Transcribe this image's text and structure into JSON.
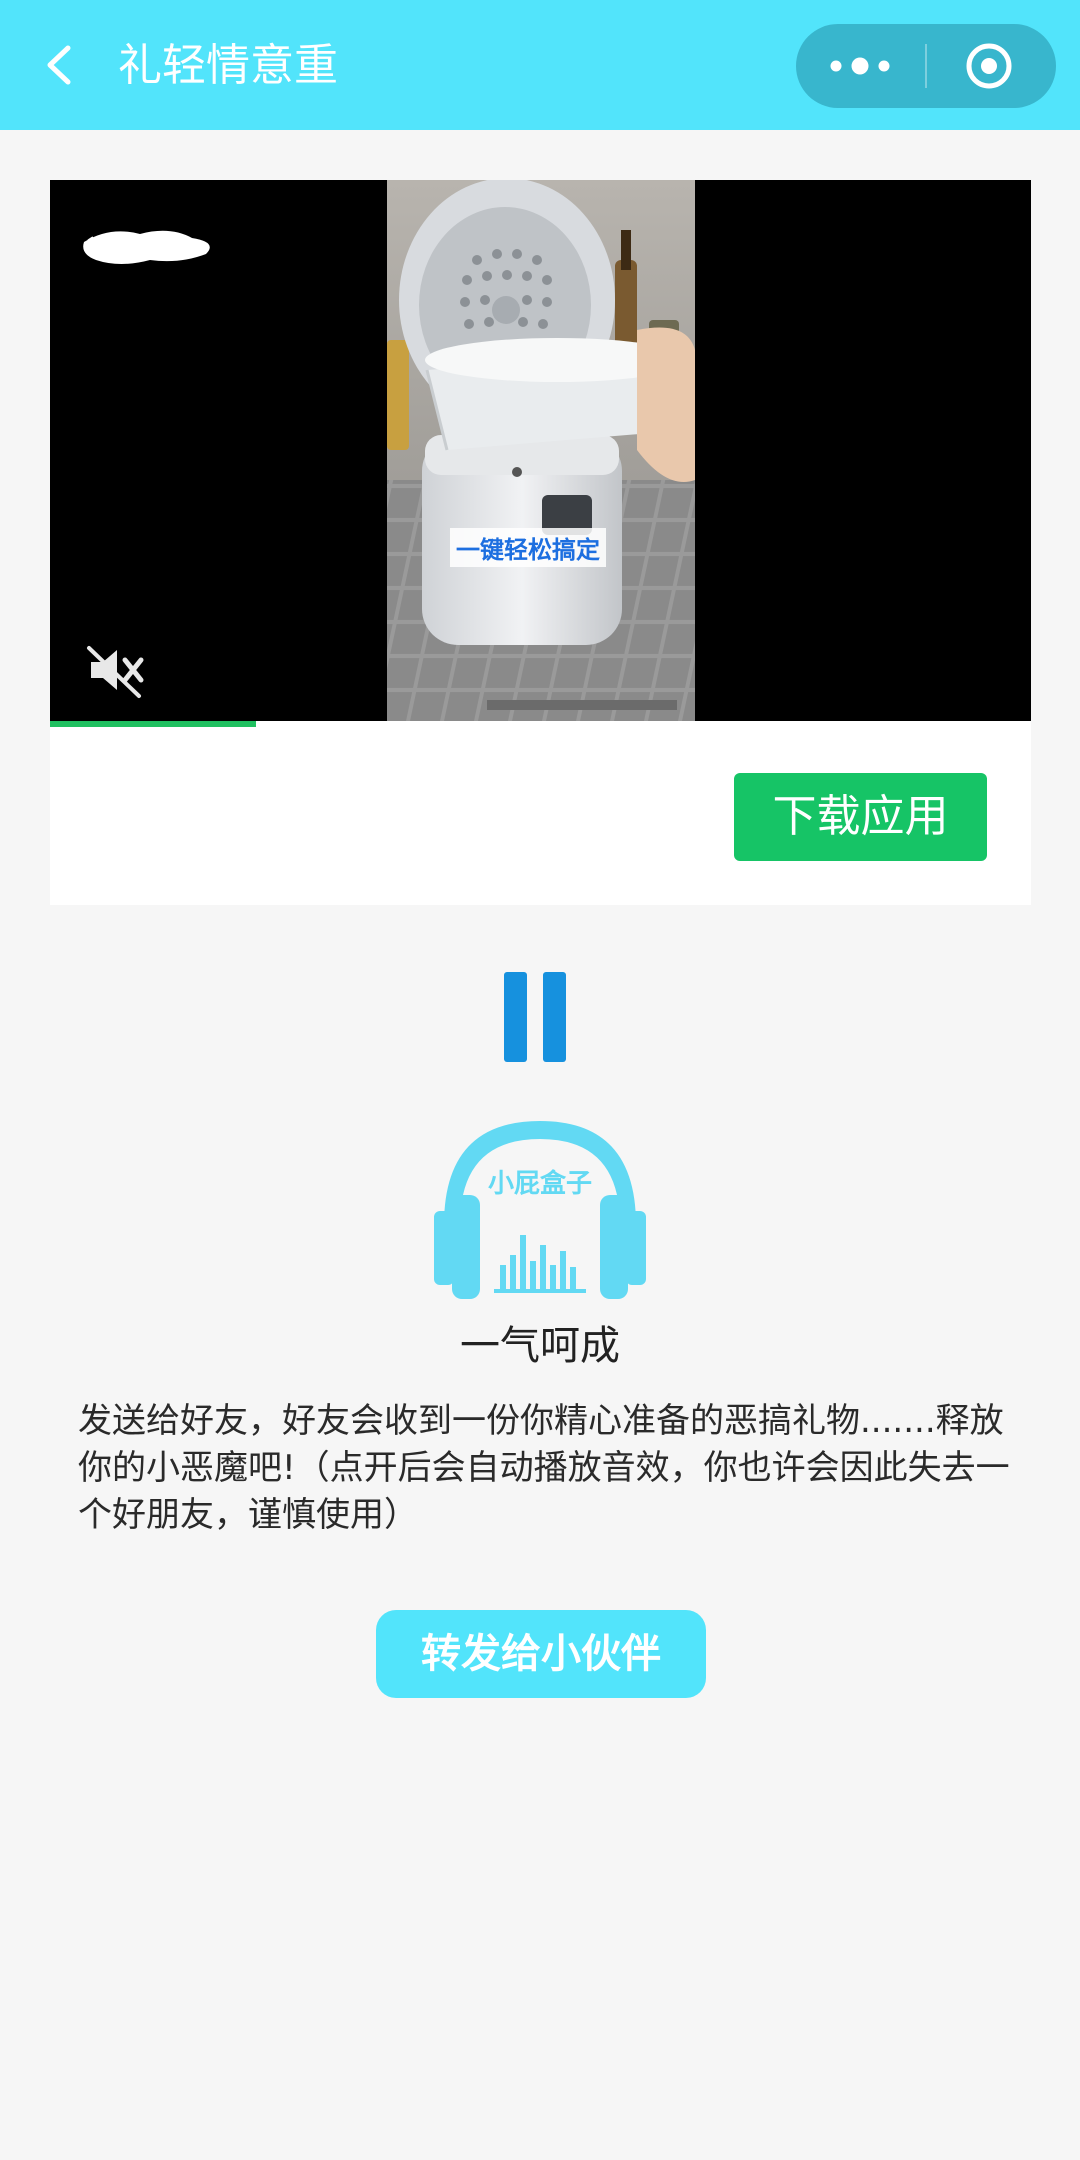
{
  "navbar": {
    "title": "礼轻情意重",
    "back_icon": "chevron-left-icon",
    "more_icon": "more-dots-icon",
    "close_icon": "target-circle-icon",
    "background_color": "#52e4fb"
  },
  "ad_card": {
    "video_caption": "一键轻松搞定",
    "muted": true,
    "mute_icon": "speaker-muted-icon",
    "progress_fraction": 0.21,
    "download_label": "下载应用",
    "download_color": "#16c466"
  },
  "player": {
    "state": "playing",
    "pause_icon": "pause-icon",
    "logo_text": "小屁盒子",
    "logo_icon": "headphones-icon",
    "sound_title": "一气呵成",
    "description": "发送给好友，好友会收到一份你精心准备的恶搞礼物.......释放你的小恶魔吧!（点开后会自动播放音效，你也许会因此失去一个好朋友，谨慎使用）",
    "share_label": "转发给小伙伴",
    "accent_color": "#1691de"
  }
}
